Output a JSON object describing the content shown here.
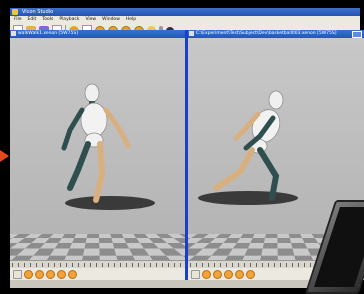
{
  "window": {
    "title": "Vicon Studio"
  },
  "menu": [
    "File",
    "Edit",
    "Tools",
    "Playback",
    "View",
    "Window",
    "Help"
  ],
  "panes": [
    {
      "title": "walkWalk1.xenon [5W75S]"
    },
    {
      "title": "C:\\Experiment\\Test\\Subject\\Dev\\basketball003.xenon [5W75S]"
    }
  ],
  "colors": {
    "titlebar": "#2453b5",
    "pane_divider": "#1c3fc6",
    "arrow": "#e34a1a",
    "figure_body": "#f0f0f0",
    "figure_dark_limb": "#2f4f4f",
    "figure_light_limb": "#d8b080"
  }
}
